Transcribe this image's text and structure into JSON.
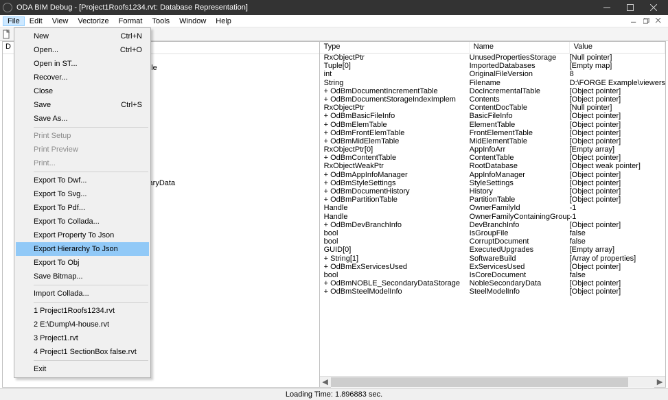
{
  "titlebar": {
    "text": "ODA BIM Debug - [Project1Roofs1234.rvt: Database Representation]"
  },
  "menubar": {
    "items": [
      "File",
      "Edit",
      "View",
      "Vectorize",
      "Format",
      "Tools",
      "Window",
      "Help"
    ]
  },
  "file_menu": {
    "items": [
      {
        "label": "New",
        "shortcut": "Ctrl+N",
        "type": "item"
      },
      {
        "label": "Open...",
        "shortcut": "Ctrl+O",
        "type": "item"
      },
      {
        "label": "Open in ST...",
        "shortcut": "",
        "type": "item"
      },
      {
        "label": "Recover...",
        "shortcut": "",
        "type": "item"
      },
      {
        "label": "Close",
        "shortcut": "",
        "type": "item"
      },
      {
        "label": "Save",
        "shortcut": "Ctrl+S",
        "type": "item"
      },
      {
        "label": "Save As...",
        "shortcut": "",
        "type": "item"
      },
      {
        "type": "sep"
      },
      {
        "label": "Print Setup",
        "shortcut": "",
        "type": "item",
        "disabled": true
      },
      {
        "label": "Print Preview",
        "shortcut": "",
        "type": "item",
        "disabled": true
      },
      {
        "label": "Print...",
        "shortcut": "",
        "type": "item",
        "disabled": true
      },
      {
        "type": "sep"
      },
      {
        "label": "Export To Dwf...",
        "shortcut": "",
        "type": "item"
      },
      {
        "label": "Export To Svg...",
        "shortcut": "",
        "type": "item"
      },
      {
        "label": "Export To Pdf...",
        "shortcut": "",
        "type": "item"
      },
      {
        "label": "Export To Collada...",
        "shortcut": "",
        "type": "item"
      },
      {
        "label": "Export Property To Json",
        "shortcut": "",
        "type": "item"
      },
      {
        "label": "Export Hierarchy To Json",
        "shortcut": "",
        "type": "item",
        "highlight": true
      },
      {
        "label": "Export To Obj",
        "shortcut": "",
        "type": "item"
      },
      {
        "label": "Save Bitmap...",
        "shortcut": "",
        "type": "item"
      },
      {
        "type": "sep"
      },
      {
        "label": "Import Collada...",
        "shortcut": "",
        "type": "item"
      },
      {
        "type": "sep"
      },
      {
        "label": "1 Project1Roofs1234.rvt",
        "shortcut": "",
        "type": "item"
      },
      {
        "label": "2 E:\\Dump\\4-house.rvt",
        "shortcut": "",
        "type": "item"
      },
      {
        "label": "3 Project1.rvt",
        "shortcut": "",
        "type": "item"
      },
      {
        "label": "4 Project1 SectionBox false.rvt",
        "shortcut": "",
        "type": "item"
      },
      {
        "type": "sep"
      },
      {
        "label": "Exit",
        "shortcut": "",
        "type": "item"
      }
    ]
  },
  "left_tree": {
    "header": "D",
    "visible_rows": [
      {
        "indent": 1,
        "text": ""
      },
      {
        "indent": 2,
        "text": "able"
      },
      {
        "indent": 2,
        "text": ""
      },
      {
        "indent": 2,
        "text": ""
      },
      {
        "indent": 2,
        "text": ""
      },
      {
        "indent": 2,
        "text": ""
      },
      {
        "indent": 2,
        "text": ""
      },
      {
        "indent": 2,
        "text": ""
      },
      {
        "indent": 2,
        "text": ""
      },
      {
        "indent": 2,
        "text": ""
      },
      {
        "indent": 2,
        "text": ""
      },
      {
        "indent": 2,
        "text": ""
      },
      {
        "indent": 2,
        "text": ""
      },
      {
        "indent": 2,
        "text": ""
      },
      {
        "indent": 2,
        "text": ""
      },
      {
        "indent": 2,
        "text": "idaryData"
      },
      {
        "indent": 2,
        "text": ""
      }
    ]
  },
  "grid": {
    "columns": [
      "Type",
      "Name",
      "Value"
    ],
    "rows": [
      {
        "type": "RxObjectPtr",
        "name": "UnusedPropertiesStorage",
        "value": "[Null pointer]"
      },
      {
        "type": "Tuple[0]",
        "name": "ImportedDatabases",
        "value": "[Empty map]"
      },
      {
        "type": "int",
        "name": "OriginalFileVersion",
        "value": "8"
      },
      {
        "type": "String",
        "name": "Filename",
        "value": "D:\\FORGE Example\\viewers"
      },
      {
        "type": "+ OdBmDocumentIncrementTable",
        "name": "DocIncrementalTable",
        "value": "[Object pointer]"
      },
      {
        "type": "+ OdBmDocumentStorageIndexImplem",
        "name": "Contents",
        "value": "[Object pointer]"
      },
      {
        "type": "RxObjectPtr",
        "name": "ContentDocTable",
        "value": "[Null pointer]"
      },
      {
        "type": "+ OdBmBasicFileInfo",
        "name": "BasicFileInfo",
        "value": "[Object pointer]"
      },
      {
        "type": "+ OdBmElemTable",
        "name": "ElementTable",
        "value": "[Object pointer]"
      },
      {
        "type": "+ OdBmFrontElemTable",
        "name": "FrontElementTable",
        "value": "[Object pointer]"
      },
      {
        "type": "+ OdBmMidElemTable",
        "name": "MidElementTable",
        "value": "[Object pointer]"
      },
      {
        "type": "RxObjectPtr[0]",
        "name": "AppInfoArr",
        "value": "[Empty array]"
      },
      {
        "type": "+ OdBmContentTable",
        "name": "ContentTable",
        "value": "[Object pointer]"
      },
      {
        "type": "RxObjectWeakPtr",
        "name": "RootDatabase",
        "value": "[Object weak pointer]"
      },
      {
        "type": "+ OdBmAppInfoManager",
        "name": "AppInfoManager",
        "value": "[Object pointer]"
      },
      {
        "type": "+ OdBmStyleSettings",
        "name": "StyleSettings",
        "value": "[Object pointer]"
      },
      {
        "type": "+ OdBmDocumentHistory",
        "name": "History",
        "value": "[Object pointer]"
      },
      {
        "type": "+ OdBmPartitionTable",
        "name": "PartitionTable",
        "value": "[Object pointer]"
      },
      {
        "type": "Handle",
        "name": "OwnerFamilyId",
        "value": "-1"
      },
      {
        "type": "Handle",
        "name": "OwnerFamilyContainingGroupId",
        "value": "-1"
      },
      {
        "type": "+ OdBmDevBranchInfo",
        "name": "DevBranchInfo",
        "value": "[Object pointer]"
      },
      {
        "type": "bool",
        "name": "IsGroupFile",
        "value": "false"
      },
      {
        "type": "bool",
        "name": "CorruptDocument",
        "value": "false"
      },
      {
        "type": "GUID[0]",
        "name": "ExecutedUpgrades",
        "value": "[Empty array]"
      },
      {
        "type": "+ String[1]",
        "name": "SoftwareBuild",
        "value": "[Array of properties]"
      },
      {
        "type": "+ OdBmExServicesUsed",
        "name": "ExServicesUsed",
        "value": "[Object pointer]"
      },
      {
        "type": "bool",
        "name": "IsCoreDocument",
        "value": "false"
      },
      {
        "type": "+ OdBmNOBLE_SecondaryDataStorage",
        "name": "NobleSecondaryData",
        "value": "[Object pointer]"
      },
      {
        "type": "+ OdBmSteelModelInfo",
        "name": "SteelModelInfo",
        "value": "[Object pointer]"
      }
    ]
  },
  "statusbar": {
    "text": "Loading Time: 1.896883 sec."
  }
}
